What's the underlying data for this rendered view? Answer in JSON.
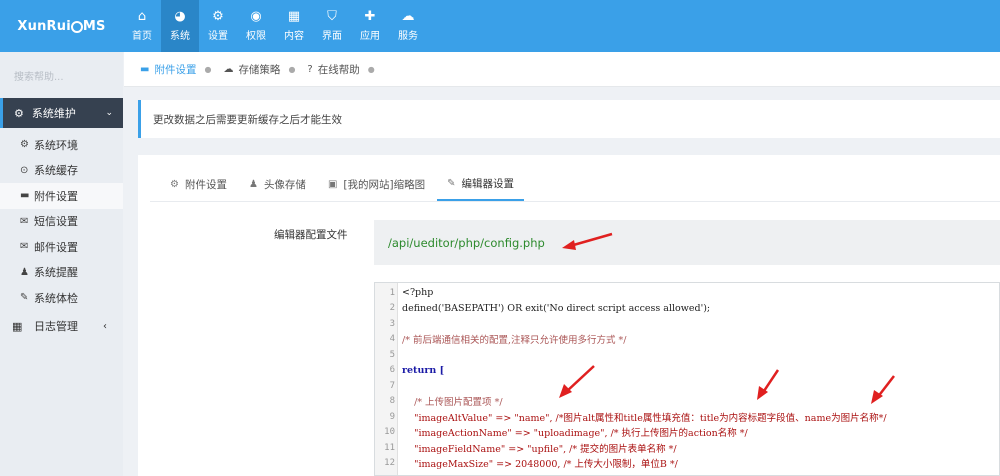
{
  "app": {
    "logo_text_a": "XunRui",
    "logo_text_b": "MS"
  },
  "nav": [
    {
      "label": "首页",
      "icon": "home-icon",
      "glyph": "⌂"
    },
    {
      "label": "系统",
      "icon": "globe-icon",
      "glyph": "◕",
      "active": true
    },
    {
      "label": "设置",
      "icon": "gears-icon",
      "glyph": "⚙"
    },
    {
      "label": "权限",
      "icon": "user-circle-icon",
      "glyph": "◉"
    },
    {
      "label": "内容",
      "icon": "grid-icon",
      "glyph": "▦"
    },
    {
      "label": "界面",
      "icon": "html5-icon",
      "glyph": "⛉"
    },
    {
      "label": "应用",
      "icon": "puzzle-icon",
      "glyph": "✚"
    },
    {
      "label": "服务",
      "icon": "cloud-icon",
      "glyph": "☁"
    }
  ],
  "sidebar": {
    "search_placeholder": "搜索帮助...",
    "group_label": "系统维护",
    "items": [
      {
        "label": "系统环境",
        "glyph": "⚙"
      },
      {
        "label": "系统缓存",
        "glyph": "⊙"
      },
      {
        "label": "附件设置",
        "glyph": "▬",
        "active": true
      },
      {
        "label": "短信设置",
        "glyph": "✉"
      },
      {
        "label": "邮件设置",
        "glyph": "✉"
      },
      {
        "label": "系统提醒",
        "glyph": "♟"
      },
      {
        "label": "系统体检",
        "glyph": "✎"
      }
    ],
    "bottom_label": "日志管理"
  },
  "breadcrumbs": [
    {
      "label": "附件设置",
      "glyph": "▬",
      "active": true
    },
    {
      "label": "存储策略",
      "glyph": "☁"
    },
    {
      "label": "在线帮助",
      "glyph": "?"
    }
  ],
  "notice": "更改数据之后需要更新缓存之后才能生效",
  "tabs": [
    {
      "label": "附件设置",
      "glyph": "⚙"
    },
    {
      "label": "头像存储",
      "glyph": "♟"
    },
    {
      "label": "[我的网站]缩略图",
      "glyph": "▣"
    },
    {
      "label": "编辑器设置",
      "glyph": "✎",
      "active": true
    }
  ],
  "form": {
    "label": "编辑器配置文件",
    "path": "/api/ueditor/php/config.php"
  },
  "code": {
    "lines": [
      {
        "n": "1",
        "t": "<?php"
      },
      {
        "n": "2",
        "t": "defined('BASEPATH') OR exit('No direct script access allowed');"
      },
      {
        "n": "3",
        "t": ""
      },
      {
        "n": "4",
        "t": "/* 前后端通信相关的配置,注释只允许使用多行方式 */"
      },
      {
        "n": "5",
        "t": ""
      },
      {
        "n": "6",
        "t": "return ["
      },
      {
        "n": "7",
        "t": ""
      },
      {
        "n": "8",
        "t": "    /* 上传图片配置项 */"
      },
      {
        "n": "9",
        "t": "    \"imageAltValue\" => \"name\", /*图片alt属性和title属性填充值：title为内容标题字段值、name为图片名称*/"
      },
      {
        "n": "10",
        "t": "    \"imageActionName\" => \"uploadimage\", /* 执行上传图片的action名称 */"
      },
      {
        "n": "11",
        "t": "    \"imageFieldName\" => \"upfile\", /* 提交的图片表单名称 */"
      },
      {
        "n": "12",
        "t": "    \"imageMaxSize\" => 2048000, /* 上传大小限制，单位B */"
      }
    ]
  },
  "colors": {
    "topbar": "#3aa0e8",
    "sidebar_group": "#364150",
    "path_text": "#2d8a2d",
    "annotation_arrow": "#e02020"
  }
}
